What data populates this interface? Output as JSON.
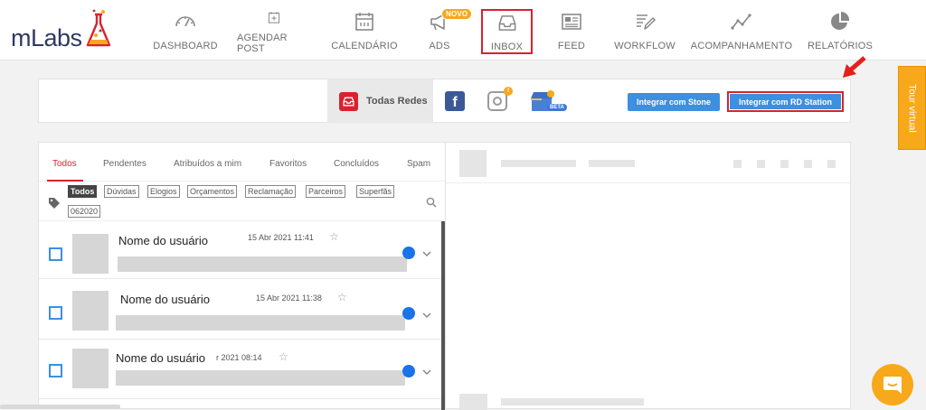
{
  "brand": {
    "name_m": "m",
    "name_labs": "Labs"
  },
  "nav": [
    {
      "label": "DASHBOARD",
      "icon": "speedometer-icon"
    },
    {
      "label": "AGENDAR POST",
      "icon": "calendar-plus-icon"
    },
    {
      "label": "CALENDÁRIO",
      "icon": "calendar-icon"
    },
    {
      "label": "ADS",
      "icon": "megaphone-icon",
      "badge": "NOVO"
    },
    {
      "label": "INBOX",
      "icon": "inbox-tray-icon",
      "active": true
    },
    {
      "label": "FEED",
      "icon": "newspaper-icon"
    },
    {
      "label": "WORKFLOW",
      "icon": "edit-list-icon"
    },
    {
      "label": "ACOMPANHAMENTO",
      "icon": "line-chart-icon"
    },
    {
      "label": "RELATÓRIOS",
      "icon": "pie-chart-icon"
    }
  ],
  "tour": {
    "label": "Tour virtual"
  },
  "networks": {
    "all_label": "Todas Redes",
    "facebook_letter": "f",
    "instagram_alert": "!",
    "gmb_badge": "BETA",
    "stone_button": "Integrar com Stone",
    "rd_button": "Integrar com RD Station"
  },
  "inbox": {
    "tabs": [
      "Todos",
      "Pendentes",
      "Atribuídos a mim",
      "Favoritos",
      "Concluídos",
      "Spam"
    ],
    "tags": [
      "Todos",
      "Dúvidas",
      "Elogios",
      "Orçamentos",
      "Reclamação",
      "Parceiros",
      "Superfãs",
      "062020"
    ],
    "messages": [
      {
        "name": "Nome do usuário",
        "date": "15 Abr 2021 11:41"
      },
      {
        "name": "Nome do usuário",
        "date": "15 Abr 2021 11:38"
      },
      {
        "name": "Nome do usuário",
        "date": "r 2021 08:14"
      }
    ]
  },
  "colors": {
    "accent_red": "#d8232f",
    "brand_orange": "#f7a81b",
    "button_blue": "#3d8fe0",
    "unread_blue": "#1a73e8"
  }
}
